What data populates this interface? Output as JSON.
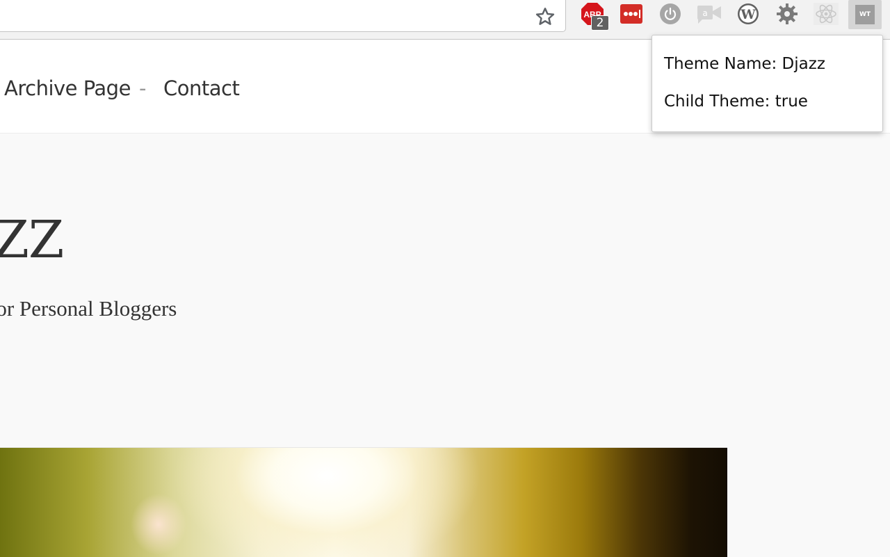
{
  "browser": {
    "extensions": [
      {
        "name": "adblock-icon",
        "badge": "2"
      },
      {
        "name": "lastpass-icon"
      },
      {
        "name": "power-icon"
      },
      {
        "name": "screencast-icon"
      },
      {
        "name": "wordpress-icon"
      },
      {
        "name": "gear-icon"
      },
      {
        "name": "react-icon"
      },
      {
        "name": "wt-icon",
        "label": "WT"
      }
    ],
    "adblock_label": "ABP"
  },
  "site": {
    "nav": [
      {
        "label": "Archive Page"
      },
      {
        "separator": "-"
      },
      {
        "label": "Contact"
      }
    ],
    "title": "AZZ",
    "tagline": "for Personal Bloggers"
  },
  "popup": {
    "theme_name": "Theme Name: Djazz",
    "child_theme": "Child Theme: true"
  },
  "colors": {
    "adblock": "#d5151b",
    "lastpass": "#d32d27",
    "wordpress": "#606060",
    "react": "#cfcfcf"
  }
}
